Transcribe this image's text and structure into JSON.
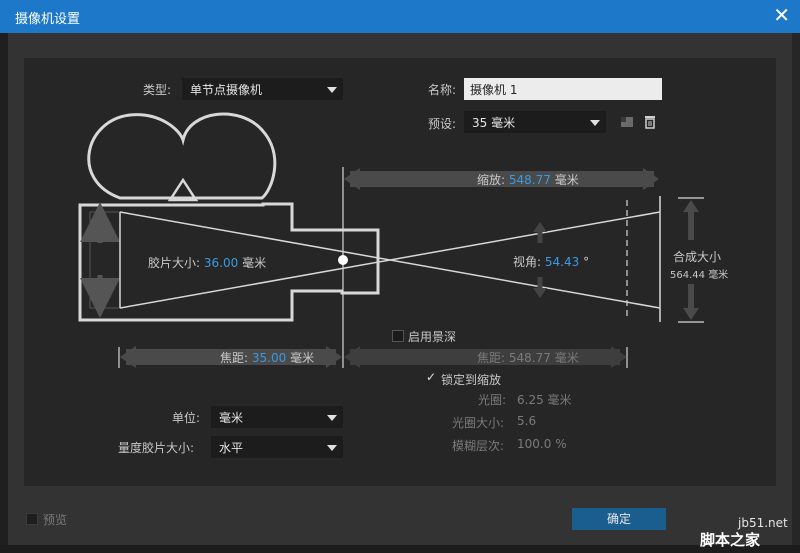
{
  "window": {
    "title": "摄像机设置"
  },
  "type_row": {
    "label": "类型:",
    "value": "单节点摄像机"
  },
  "name_row": {
    "label": "名称:",
    "value": "摄像机 1"
  },
  "preset_row": {
    "label": "预设:",
    "value": "35 毫米"
  },
  "zoom": {
    "label": "缩放:",
    "value": "548.77",
    "unit": "毫米"
  },
  "film_size": {
    "label": "胶片大小:",
    "value": "36.00",
    "unit": "毫米"
  },
  "angle": {
    "label": "视角:",
    "value": "54.43",
    "unit": "°"
  },
  "comp_size": {
    "label": "合成大小",
    "value": "564.44",
    "unit": "毫米"
  },
  "depth": {
    "label": "启用景深",
    "checked": false
  },
  "focal": {
    "label": "焦距:",
    "value": "35.00",
    "unit": "毫米"
  },
  "focus_distance": {
    "label": "焦距:",
    "value": "548.77",
    "unit": "毫米"
  },
  "lock_zoom": {
    "label": "锁定到缩放",
    "checked": true
  },
  "aperture": {
    "label": "光圈:",
    "value": "6.25",
    "unit": "毫米"
  },
  "fstop": {
    "label": "光圈大小:",
    "value": "5.6"
  },
  "blur": {
    "label": "模糊层次:",
    "value": "100.0",
    "unit": "%"
  },
  "units": {
    "label": "单位:",
    "value": "毫米"
  },
  "film_measure": {
    "label": "量度胶片大小:",
    "value": "水平"
  },
  "preview": {
    "label": "预览",
    "checked": false
  },
  "ok_button": {
    "label": "确定"
  },
  "watermark": {
    "line1": "jb51.net",
    "line2": "脚本之家"
  },
  "colors": {
    "titlebar": "#1d78c9",
    "accent_value": "#3a9ae0",
    "ok_button": "#1a5d8f"
  },
  "icons": [
    "close-icon",
    "dropdown-arrow-icon",
    "save-preset-icon",
    "trash-icon",
    "camera-diagram-icon"
  ]
}
